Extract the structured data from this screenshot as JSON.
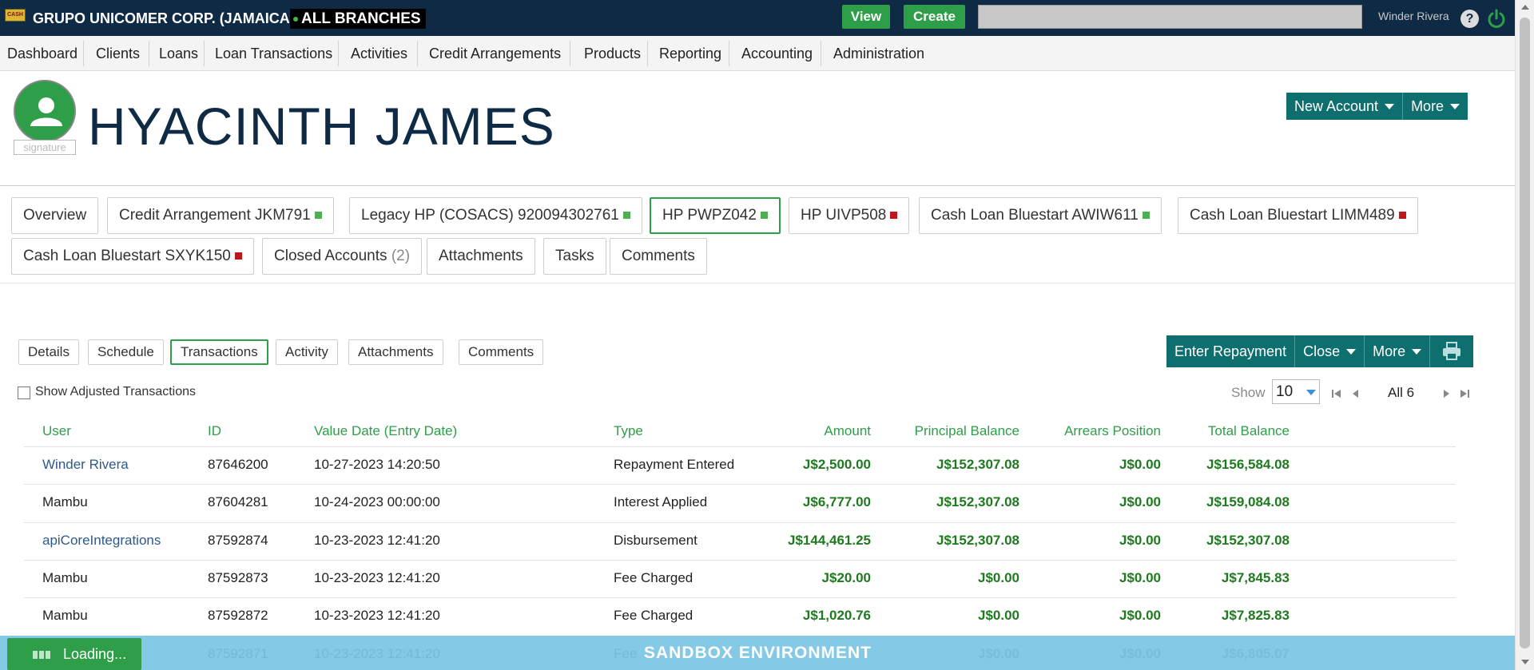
{
  "topbar": {
    "logo_text": "CASH",
    "org_name": "GRUPO UNICOMER CORP. (JAMAICA)",
    "branch": "ALL BRANCHES",
    "view_label": "View",
    "create_label": "Create",
    "search_placeholder": "",
    "user_name": "Winder Rivera",
    "help_glyph": "?",
    "colors": {
      "bar": "#0e2a45",
      "green": "#2e9e48"
    }
  },
  "nav": {
    "items": [
      "Dashboard",
      "Clients",
      "Loans",
      "Loan Transactions",
      "Activities",
      "Credit Arrangements",
      "Products",
      "Reporting",
      "Accounting",
      "Administration"
    ]
  },
  "client": {
    "signature_label": "signature",
    "name": "HYACINTH JAMES",
    "new_account_label": "New Account",
    "more_label": "More"
  },
  "account_tabs": [
    {
      "label": "Overview",
      "status": ""
    },
    {
      "label": "Credit Arrangement JKM791",
      "status": "green"
    },
    {
      "label": "Legacy HP (COSACS) 920094302761",
      "status": "green"
    },
    {
      "label": "HP PWPZ042",
      "status": "green",
      "active": true
    },
    {
      "label": "HP UIVP508",
      "status": "red"
    },
    {
      "label": "Cash Loan Bluestart AWIW611",
      "status": "green"
    },
    {
      "label": "Cash Loan Bluestart LIMM489",
      "status": "red"
    },
    {
      "label": "Cash Loan Bluestart SXYK150",
      "status": "red"
    },
    {
      "label": "Closed Accounts",
      "count": "(2)",
      "status": ""
    },
    {
      "label": "Attachments",
      "status": ""
    },
    {
      "label": "Tasks",
      "status": ""
    },
    {
      "label": "Comments",
      "status": ""
    }
  ],
  "status_colors": {
    "green": "#4caf50",
    "red": "#c0161b"
  },
  "sub_tabs": [
    "Details",
    "Schedule",
    "Transactions",
    "Activity",
    "Attachments",
    "Comments"
  ],
  "actions": {
    "enter_repayment": "Enter Repayment",
    "close": "Close",
    "more": "More"
  },
  "filters": {
    "show_adjusted": "Show Adjusted Transactions",
    "show_label": "Show",
    "page_size": "10",
    "page_info": "All 6"
  },
  "table": {
    "columns": [
      "User",
      "ID",
      "Value Date (Entry Date)",
      "Type",
      "Amount",
      "Principal Balance",
      "Arrears Position",
      "Total Balance"
    ],
    "rows": [
      [
        "Winder Rivera",
        "87646200",
        "10-27-2023 14:20:50",
        "Repayment Entered",
        "J$2,500.00",
        "J$152,307.08",
        "J$0.00",
        "J$156,584.08"
      ],
      [
        "Mambu",
        "87604281",
        "10-24-2023 00:00:00",
        "Interest Applied",
        "J$6,777.00",
        "J$152,307.08",
        "J$0.00",
        "J$159,084.08"
      ],
      [
        "apiCoreIntegrations",
        "87592874",
        "10-23-2023 12:41:20",
        "Disbursement",
        "J$144,461.25",
        "J$152,307.08",
        "J$0.00",
        "J$152,307.08"
      ],
      [
        "Mambu",
        "87592873",
        "10-23-2023 12:41:20",
        "Fee Charged",
        "J$20.00",
        "J$0.00",
        "J$0.00",
        "J$7,845.83"
      ],
      [
        "Mambu",
        "87592872",
        "10-23-2023 12:41:20",
        "Fee Charged",
        "J$1,020.76",
        "J$0.00",
        "J$0.00",
        "J$7,825.83"
      ],
      [
        "",
        "87592871",
        "10-23-2023 12:41:20",
        "Fee",
        "",
        "J$0.00",
        "J$0.00",
        "J$6,805.07"
      ]
    ],
    "linked_users": [
      "Winder Rivera",
      "apiCoreIntegrations"
    ]
  },
  "footer": {
    "sandbox": "SANDBOX ENVIRONMENT",
    "loading": "Loading..."
  }
}
